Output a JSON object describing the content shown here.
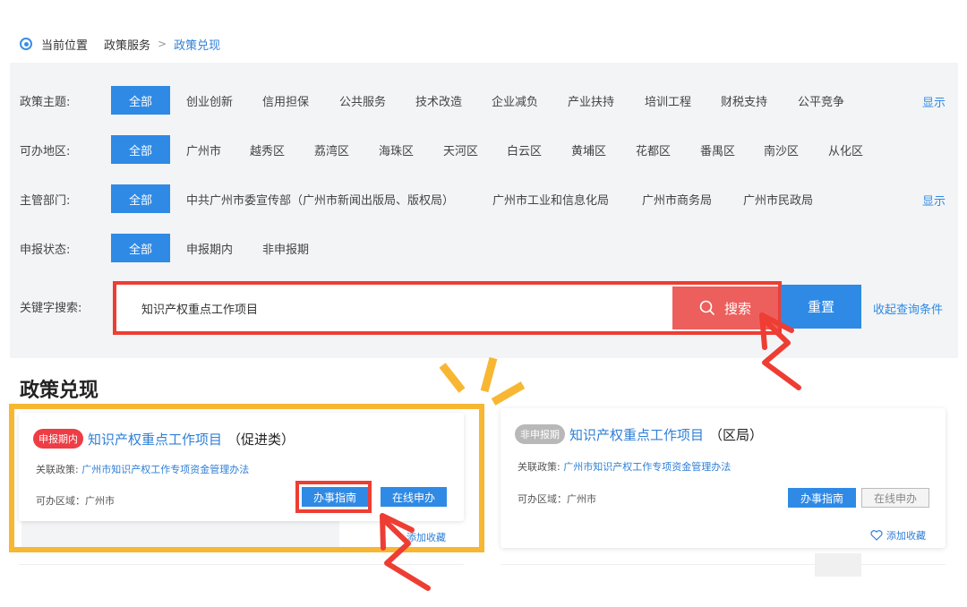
{
  "breadcrumb": {
    "label": "当前位置",
    "items": [
      "政策服务",
      "政策兑现"
    ],
    "separator": ">"
  },
  "filters": {
    "topic": {
      "label": "政策主题:",
      "all": "全部",
      "options": [
        "创业创新",
        "信用担保",
        "公共服务",
        "技术改造",
        "企业减负",
        "产业扶持",
        "培训工程",
        "财税支持",
        "公平竞争"
      ],
      "show": "显示"
    },
    "region": {
      "label": "可办地区:",
      "all": "全部",
      "options": [
        "广州市",
        "越秀区",
        "荔湾区",
        "海珠区",
        "天河区",
        "白云区",
        "黄埔区",
        "花都区",
        "番禺区",
        "南沙区",
        "从化区"
      ]
    },
    "dept": {
      "label": "主管部门:",
      "all": "全部",
      "options": [
        "中共广州市委宣传部（广州市新闻出版局、版权局）",
        "广州市工业和信息化局",
        "广州市商务局",
        "广州市民政局"
      ],
      "show": "显示"
    },
    "status": {
      "label": "申报状态:",
      "all": "全部",
      "options": [
        "申报期内",
        "非申报期"
      ]
    }
  },
  "search": {
    "label": "关键字搜索:",
    "value": "知识产权重点工作项目",
    "button": "搜索",
    "reset": "重置",
    "collapse": "收起查询条件"
  },
  "section_title": "政策兑现",
  "cards": [
    {
      "status": "申报期内",
      "title": "知识产权重点工作项目",
      "subtitle": "（促进类）",
      "policy_label": "关联政策:",
      "policy": "广州市知识产权工作专项资金管理办法",
      "area": "可办区域：广州市",
      "guide": "办事指南",
      "apply": "在线申办",
      "favorite": "添加收藏"
    },
    {
      "status": "非申报期",
      "title": "知识产权重点工作项目",
      "subtitle": "（区局）",
      "policy_label": "关联政策:",
      "policy": "广州市知识产权工作专项资金管理办法",
      "area": "可办区域：广州市",
      "guide": "办事指南",
      "apply": "在线申办",
      "favorite": "添加收藏"
    }
  ],
  "colors": {
    "primary": "#2f8ae5",
    "highlight_red": "#ee3d33",
    "highlight_yellow": "#f7b733",
    "search_button": "#ec5f5c",
    "panel_bg": "#f3f4f5",
    "active_tag": "#ee3d45",
    "inactive_tag": "#b8b8b8"
  },
  "icons": [
    "location-dot-icon",
    "search-icon",
    "heart-icon",
    "arrow-annotation-icon",
    "sparkle-annotation-icon"
  ]
}
